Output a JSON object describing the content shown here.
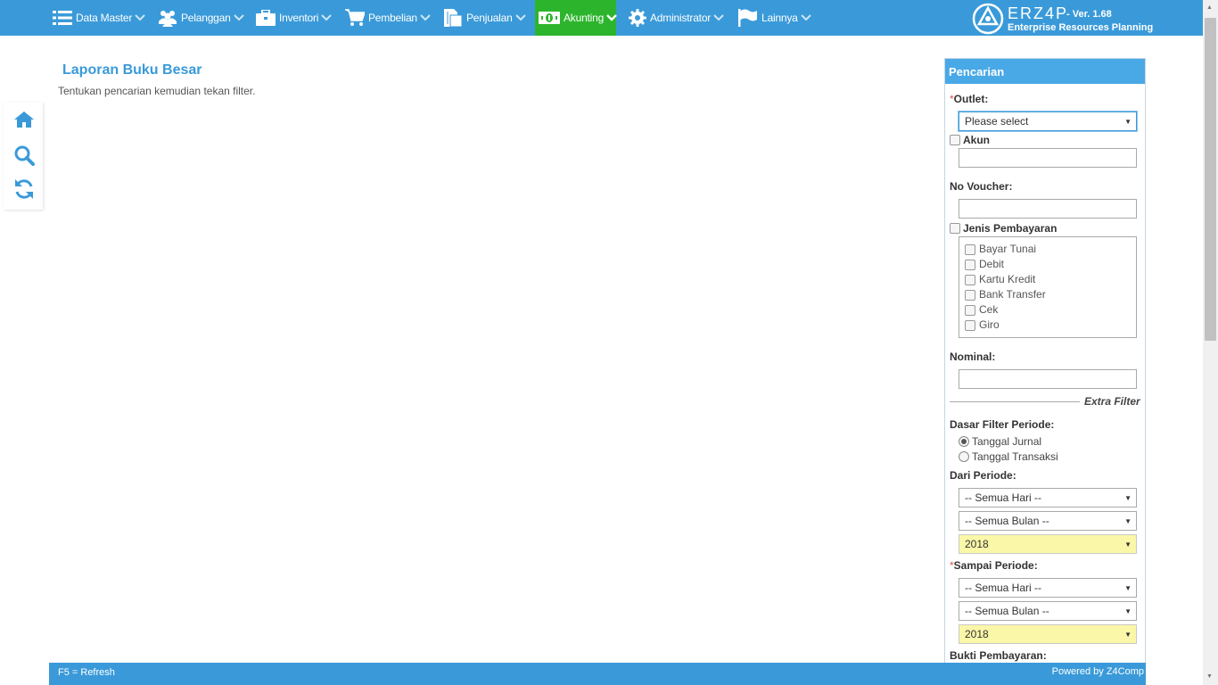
{
  "nav": {
    "items": [
      {
        "label": "Data Master",
        "icon": "list-icon"
      },
      {
        "label": "Pelanggan",
        "icon": "users-icon"
      },
      {
        "label": "Inventori",
        "icon": "briefcase-icon"
      },
      {
        "label": "Pembelian",
        "icon": "cart-icon"
      },
      {
        "label": "Penjualan",
        "icon": "document-icon"
      },
      {
        "label": "Akunting",
        "icon": "money-icon",
        "active": true
      },
      {
        "label": "Administrator",
        "icon": "gear-icon"
      },
      {
        "label": "Lainnya",
        "icon": "flag-icon"
      }
    ],
    "accent": "#3a9ad9",
    "active_color": "#2cb52c"
  },
  "brand": {
    "name": "ERZ4P",
    "version": "- Ver. 1.68",
    "subtitle": "Enterprise Resources Planning"
  },
  "sidebar_tools": [
    "home-icon",
    "search-icon",
    "refresh-icon"
  ],
  "page": {
    "title": "Laporan Buku Besar",
    "hint": "Tentukan pencarian kemudian tekan filter."
  },
  "search": {
    "title": "Pencarian",
    "outlet_label": "Outlet:",
    "outlet_value": "Please select",
    "akun_label": "Akun",
    "akun_value": "",
    "voucher_label": "No Voucher:",
    "voucher_value": "",
    "jenis_label": "Jenis Pembayaran",
    "jenis_options": [
      "Bayar Tunai",
      "Debit",
      "Kartu Kredit",
      "Bank Transfer",
      "Cek",
      "Giro"
    ],
    "nominal_label": "Nominal:",
    "nominal_value": "",
    "extra_filter": "Extra Filter",
    "dasar_label": "Dasar Filter Periode:",
    "dasar_options": [
      "Tanggal Jurnal",
      "Tanggal Transaksi"
    ],
    "dasar_selected": "Tanggal Jurnal",
    "dari_label": "Dari Periode:",
    "dari_hari": "-- Semua Hari --",
    "dari_bulan": "-- Semua Bulan --",
    "dari_tahun": "2018",
    "sampai_label": "Sampai Periode:",
    "sampai_hari": "-- Semua Hari --",
    "sampai_bulan": "-- Semua Bulan --",
    "sampai_tahun": "2018",
    "bukti_label": "Bukti Pembayaran:",
    "required_mark": "*"
  },
  "footer": {
    "left": "F5 = Refresh",
    "right_prefix": "Powered by",
    "right_brand": "Z4Comp"
  }
}
